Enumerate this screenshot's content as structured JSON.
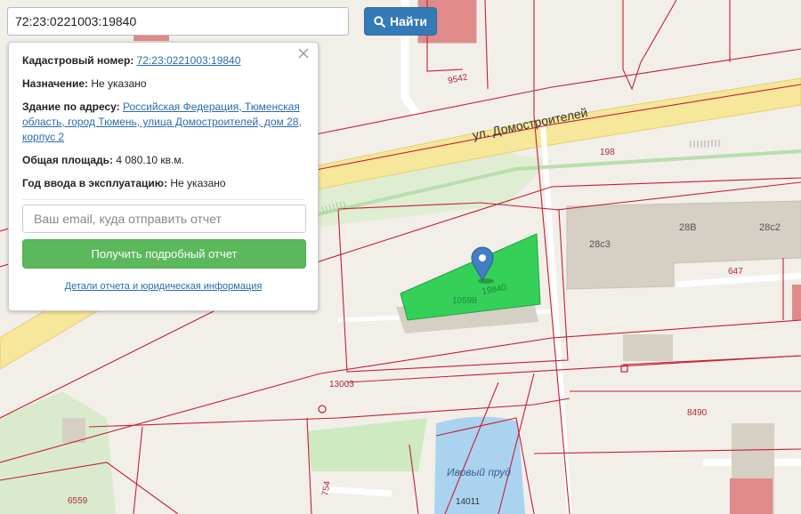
{
  "search": {
    "value": "72:23:0221003:19840",
    "button_label": "Найти"
  },
  "info": {
    "cadastral_label": "Кадастровый номер:",
    "cadastral_value": "72:23:0221003:19840",
    "purpose_label": "Назначение:",
    "purpose_value": "Не указано",
    "address_label": "Здание по адресу:",
    "address_value": "Российская Федерация, Тюменская область, город Тюмень, улица Домостроителей, дом 28, корпус 2",
    "area_label": "Общая площадь:",
    "area_value": "4 080.10 кв.м.",
    "year_label": "Год ввода в эксплуатацию:",
    "year_value": "Не указано",
    "email_placeholder": "Ваш email, куда отправить отчет",
    "report_button": "Получить подробный отчет",
    "details_link": "Детали отчета и юридическая информация"
  },
  "map": {
    "street_label": "ул. Домостроителей",
    "pond_label": "Ивовый пруд",
    "parcel_labels": [
      "9542",
      "198",
      "647",
      "13003",
      "8490",
      "6559",
      "754",
      "14011"
    ],
    "building_labels": [
      "28с3",
      "28В",
      "28с2"
    ],
    "selected_labels": [
      "10598",
      "19840"
    ],
    "colors": {
      "background": "#f2efe9",
      "road": "#f6e79a",
      "boundary": "#c81e36",
      "selected": "#34d058",
      "building": "#d6cfc4",
      "water": "#aad3f0",
      "green": "#cdeac0",
      "marker": "#3f7fc4"
    }
  },
  "icons": {
    "search": "search-icon",
    "close": "close-icon",
    "marker": "map-marker-icon"
  }
}
